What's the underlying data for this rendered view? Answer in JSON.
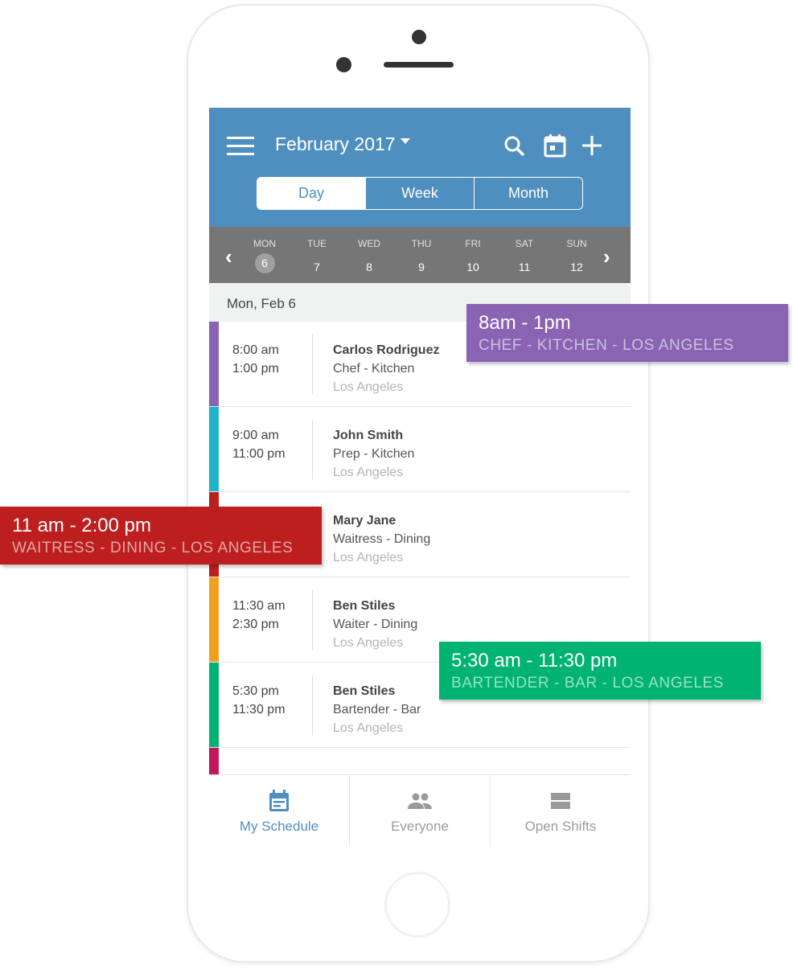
{
  "header": {
    "title": "February 2017",
    "icons": [
      "menu-icon",
      "search-icon",
      "calendar-icon",
      "plus-icon"
    ]
  },
  "view_tabs": [
    {
      "label": "Day",
      "selected": true
    },
    {
      "label": "Week"
    },
    {
      "label": "Month"
    }
  ],
  "week": [
    {
      "name": "MON",
      "date": "6",
      "selected": true
    },
    {
      "name": "TUE",
      "date": "7"
    },
    {
      "name": "WED",
      "date": "8"
    },
    {
      "name": "THU",
      "date": "9"
    },
    {
      "name": "FRI",
      "date": "10"
    },
    {
      "name": "SAT",
      "date": "11"
    },
    {
      "name": "SUN",
      "date": "12"
    }
  ],
  "date_header": "Mon, Feb 6",
  "shifts": [
    {
      "start": "8:00 am",
      "end": "1:00 pm",
      "name": "Carlos Rodriguez",
      "role": "Chef - Kitchen",
      "location": "Los Angeles",
      "color": "#8a63b3"
    },
    {
      "start": "9:00 am",
      "end": "11:00 pm",
      "name": "John Smith",
      "role": "Prep - Kitchen",
      "location": "Los Angeles",
      "color": "#1fb3c9"
    },
    {
      "name": "Mary Jane",
      "role": "Waitress - Dining",
      "location": "Los Angeles",
      "color": "#bd1e1e"
    },
    {
      "start": "11:30 am",
      "end": "2:30 pm",
      "name": "Ben Stiles",
      "role": "Waiter - Dining",
      "location": "Los Angeles",
      "color": "#f0a020"
    },
    {
      "start": "5:30 pm",
      "end": "11:30 pm",
      "name": "Ben Stiles",
      "role": "Bartender - Bar",
      "location": "Los Angeles",
      "color": "#00b373"
    },
    {
      "color": "#c2185b"
    }
  ],
  "bottom_tabs": [
    {
      "label": "My Schedule",
      "selected": true
    },
    {
      "label": "Everyone"
    },
    {
      "label": "Open Shifts"
    }
  ],
  "callouts": [
    {
      "time": "8am - 1pm",
      "detail": "CHEF - KITCHEN - LOS ANGELES",
      "color": "#8a63b3"
    },
    {
      "time": "11 am - 2:00 pm",
      "detail": "WAITRESS - DINING - LOS ANGELES",
      "color": "#bd1e1e"
    },
    {
      "time": "5:30 am - 11:30 pm",
      "detail": "BARTENDER - BAR - LOS ANGELES",
      "color": "#00b373"
    }
  ],
  "colors": {
    "primary": "#4f8fbf",
    "week_bar": "#767676"
  }
}
